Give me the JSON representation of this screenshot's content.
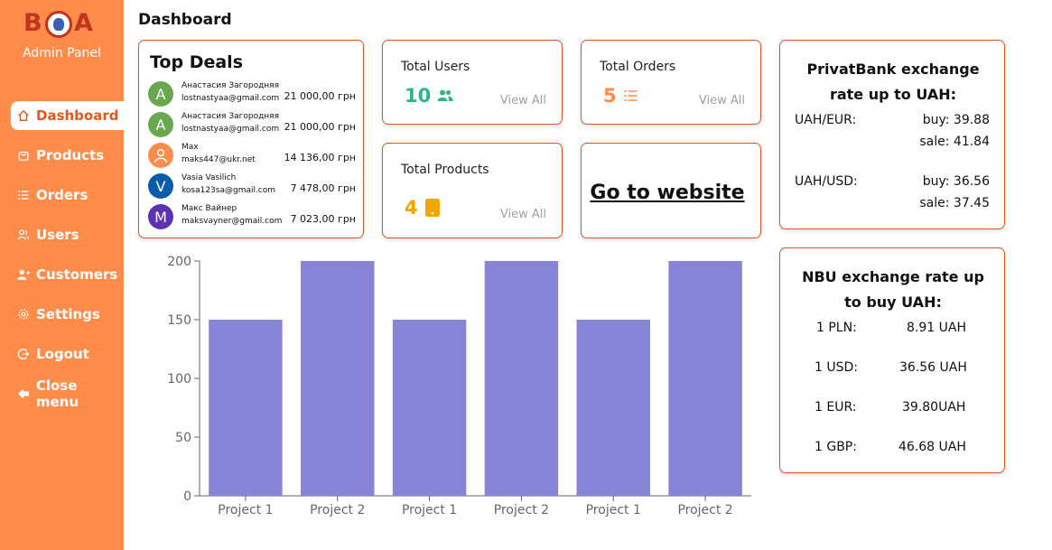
{
  "brand": {
    "logo_left": "B",
    "logo_right": "A",
    "subtitle": "Admin Panel"
  },
  "sidebar": {
    "items": [
      {
        "label": "Dashboard",
        "icon": "home-icon",
        "active": true
      },
      {
        "label": "Products",
        "icon": "bag-icon"
      },
      {
        "label": "Orders",
        "icon": "list-icon"
      },
      {
        "label": "Users",
        "icon": "users-icon"
      },
      {
        "label": "Customers",
        "icon": "customers-icon"
      },
      {
        "label": "Settings",
        "icon": "gear-icon"
      },
      {
        "label": "Logout",
        "icon": "logout-icon"
      },
      {
        "label": "Close menu",
        "icon": "arrow-left-icon"
      }
    ]
  },
  "page": {
    "title": "Dashboard"
  },
  "top_deals": {
    "title": "Top Deals",
    "deals": [
      {
        "initial": "A",
        "avatar_color": "#6aa84f",
        "name": "Анастасия Загородняя",
        "email": "lostnastyaa@gmail.com",
        "amount": "21 000,00 грн"
      },
      {
        "initial": "A",
        "avatar_color": "#6aa84f",
        "name": "Анастасия Загородняя",
        "email": "lostnastyaa@gmail.com",
        "amount": "21 000,00 грн"
      },
      {
        "initial": "",
        "avatar_color": "#ff8c4b",
        "name": "Max",
        "email": "maks447@ukr.net",
        "amount": "14 136,00 грн"
      },
      {
        "initial": "V",
        "avatar_color": "#0b5ca8",
        "name": "Vasia Vasilich",
        "email": "kosa123sa@gmail.com",
        "amount": "7 478,00 грн"
      },
      {
        "initial": "M",
        "avatar_color": "#5b32b4",
        "name": "Макс Вайнер",
        "email": "maksvayner@gmail.com",
        "amount": "7 023,00 грн"
      }
    ]
  },
  "stats": {
    "users": {
      "title": "Total Users",
      "value": "10",
      "link": "View All",
      "color": "#2fb38a"
    },
    "orders": {
      "title": "Total Orders",
      "value": "5",
      "link": "View All",
      "color": "#ff8c4b"
    },
    "products": {
      "title": "Total Products",
      "value": "4",
      "link": "View All",
      "color": "#f0a500"
    }
  },
  "go_website": {
    "label": "Go to website"
  },
  "privat": {
    "title_line1": "PrivatBank exchange",
    "title_line2": "rate up to UAH:",
    "eur_label": "UAH/EUR:",
    "eur_buy": "buy:  39.88",
    "eur_sale": "sale:  41.84",
    "usd_label": "UAH/USD:",
    "usd_buy": "buy:  36.56",
    "usd_sale": "sale:  37.45"
  },
  "nbu": {
    "title_line1": "NBU exchange rate up",
    "title_line2": "to buy UAH:",
    "rows": [
      {
        "currency": "1 PLN:",
        "rate": "8.91 UAH"
      },
      {
        "currency": "1 USD:",
        "rate": "36.56 UAH"
      },
      {
        "currency": "1 EUR:",
        "rate": "39.80UAH"
      },
      {
        "currency": "1 GBP:",
        "rate": "46.68 UAH"
      }
    ]
  },
  "chart_data": {
    "type": "bar",
    "categories": [
      "Project 1",
      "Project 2",
      "Project 1",
      "Project 2",
      "Project 1",
      "Project 2"
    ],
    "values": [
      150,
      200,
      150,
      200,
      150,
      200
    ],
    "ylim": [
      0,
      200
    ],
    "yticks": [
      0,
      50,
      100,
      150,
      200
    ],
    "bar_color": "#8884d8",
    "grid": false,
    "title": "",
    "xlabel": "",
    "ylabel": ""
  }
}
